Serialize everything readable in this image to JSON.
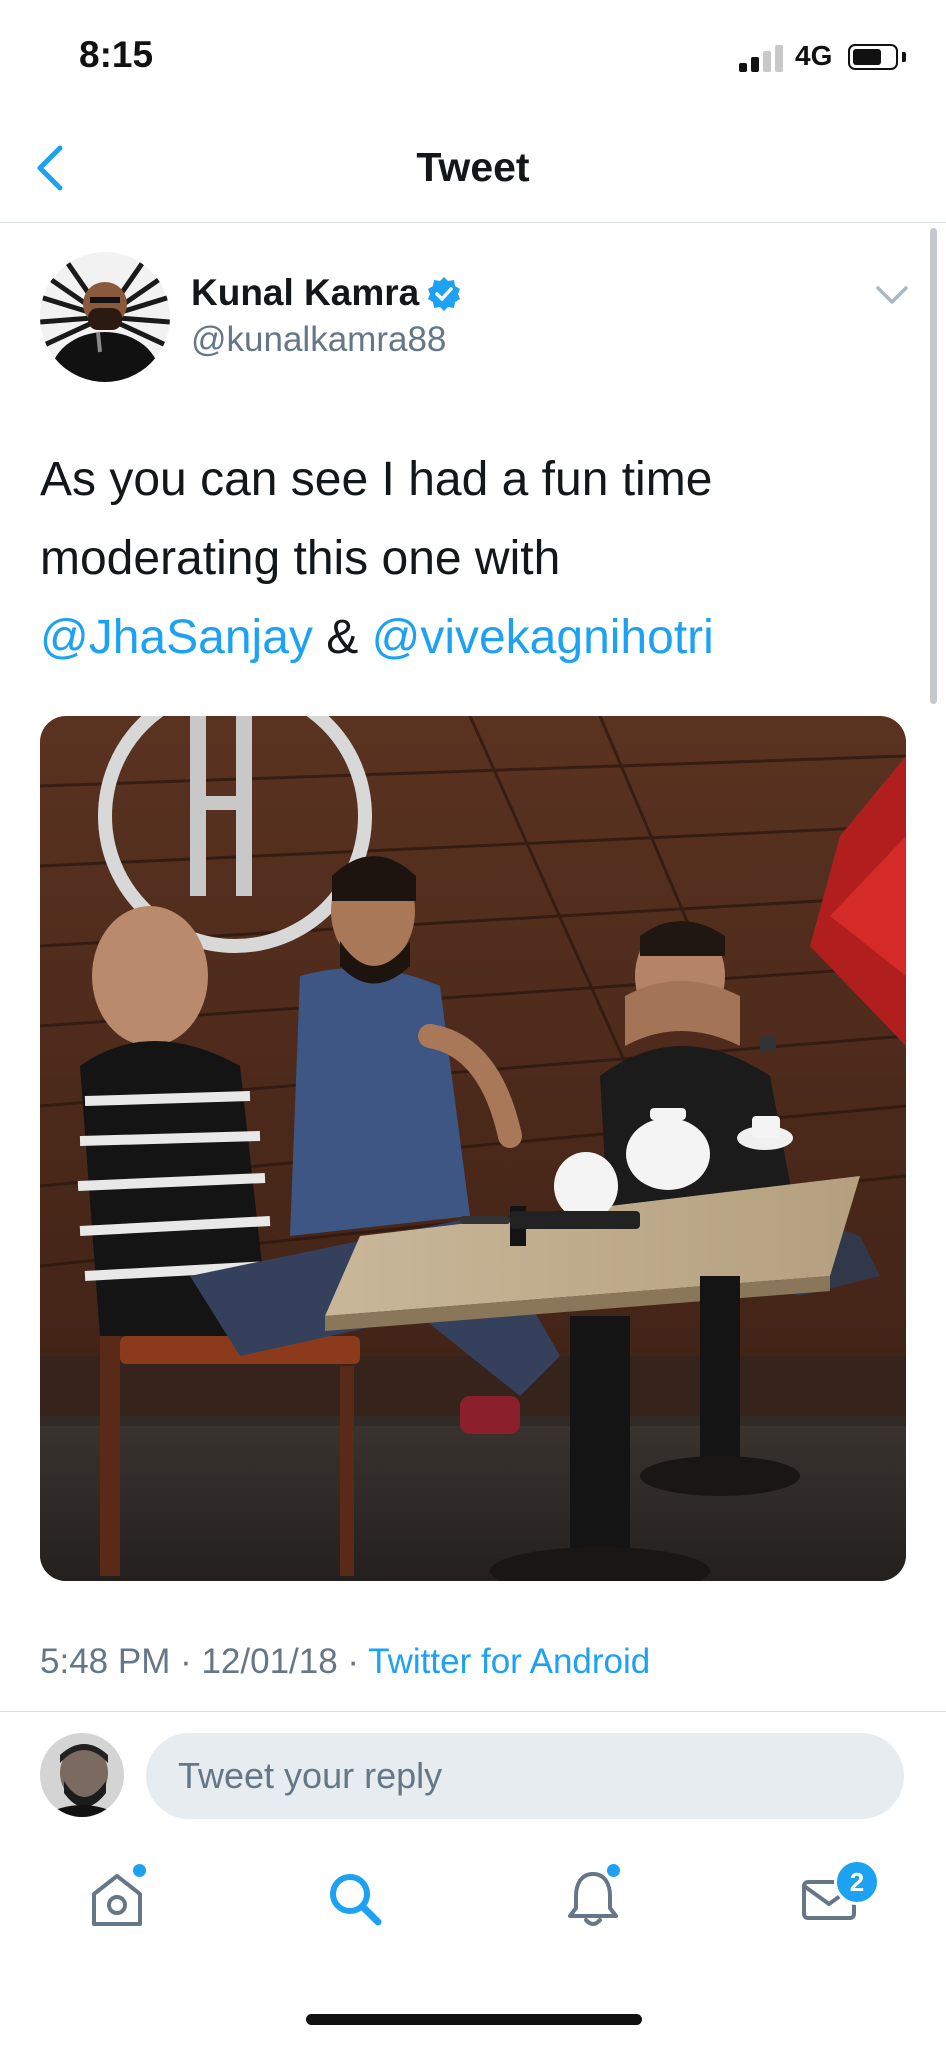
{
  "status_bar": {
    "time": "8:15",
    "network": "4G"
  },
  "nav": {
    "title": "Tweet"
  },
  "tweet": {
    "author_name": "Kunal Kamra",
    "author_handle": "@kunalkamra88",
    "text_line1": "As you can see I had a fun time",
    "text_line2": "moderating this one with",
    "mention1": "@JhaSanjay",
    "amp": "&",
    "mention2": "@vivekagnihotri",
    "timestamp": "5:48 PM · 12/01/18 · ",
    "source": "Twitter for Android"
  },
  "reply": {
    "placeholder": "Tweet your reply"
  },
  "tabs": [
    {
      "icon": "home-icon",
      "has_dot": true
    },
    {
      "icon": "search-icon",
      "active": true
    },
    {
      "icon": "bell-icon",
      "has_dot": true
    },
    {
      "icon": "mail-icon",
      "badge": "2"
    }
  ],
  "colors": {
    "accent": "#1da1f2",
    "secondary_text": "#657786",
    "primary_text": "#14171a"
  }
}
